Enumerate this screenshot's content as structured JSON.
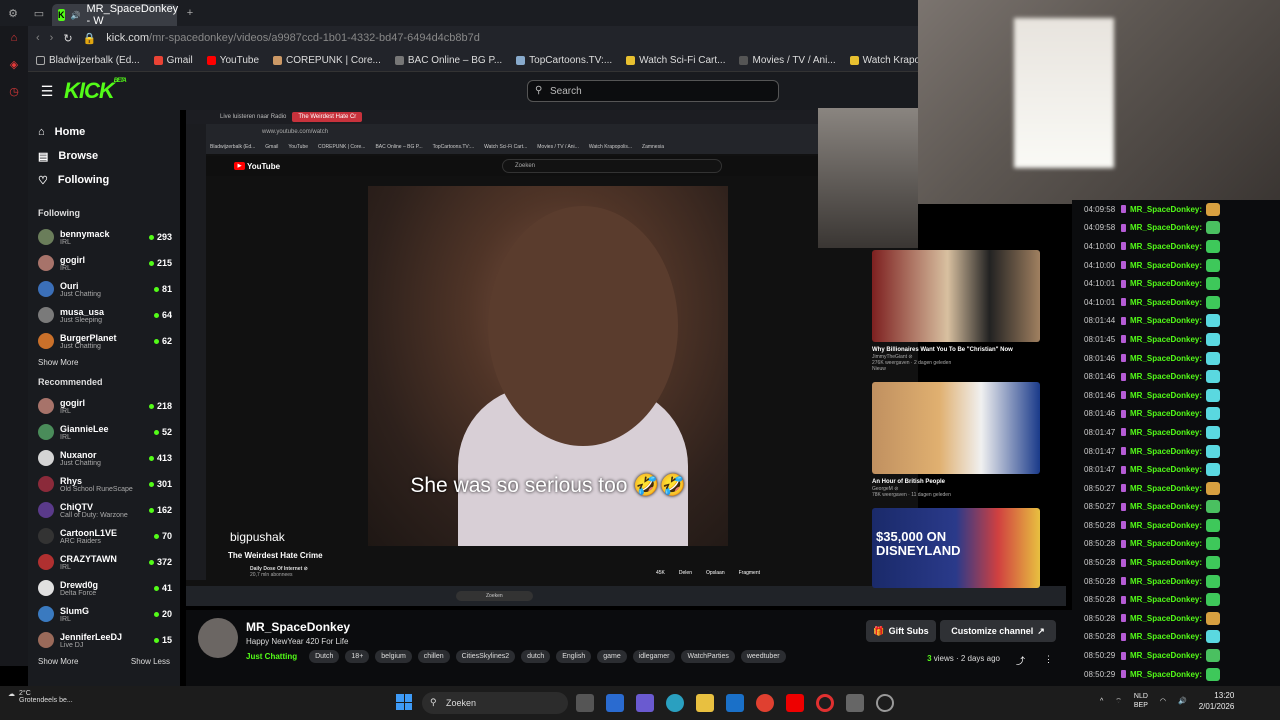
{
  "browser": {
    "tab_title": "MR_SpaceDonkey - W",
    "url_host": "kick.com",
    "url_path": "/mr-spacedonkey/videos/a9987ccd-1b01-4332-bd47-6494d4cb8b7d",
    "bookmarks": [
      "Bladwijzerbalk (Ed...",
      "Gmail",
      "YouTube",
      "COREPUNK | Core...",
      "BAC Online – BG P...",
      "TopCartoons.TV:...",
      "Watch Sci-Fi Cart...",
      "Movies / TV / Ani...",
      "Watch Krapopolis...",
      "Zamnesia"
    ]
  },
  "kick": {
    "logo": "KICK",
    "search_placeholder": "Search",
    "nav": [
      {
        "label": "Home",
        "icon": "home-icon"
      },
      {
        "label": "Browse",
        "icon": "browse-icon"
      },
      {
        "label": "Following",
        "icon": "heart-icon"
      }
    ],
    "following_title": "Following",
    "following": [
      {
        "name": "bennymack",
        "category": "IRL",
        "viewers": "293",
        "color": "#6a7d5a"
      },
      {
        "name": "gogirl",
        "category": "IRL",
        "viewers": "215",
        "color": "#a7736a"
      },
      {
        "name": "Ouri",
        "category": "Just Chatting",
        "viewers": "81",
        "color": "#3b6fb8"
      },
      {
        "name": "musa_usa",
        "category": "Just Sleeping",
        "viewers": "64",
        "color": "#7a7a7a"
      },
      {
        "name": "BurgerPlanet",
        "category": "Just Chatting",
        "viewers": "62",
        "color": "#c9702a"
      }
    ],
    "show_more": "Show More",
    "recommended_title": "Recommended",
    "recommended": [
      {
        "name": "gogirl",
        "category": "IRL",
        "viewers": "218",
        "color": "#a7736a"
      },
      {
        "name": "GiannieLee",
        "category": "IRL",
        "viewers": "52",
        "color": "#4a8c5a"
      },
      {
        "name": "Nuxanor",
        "category": "Just Chatting",
        "viewers": "413",
        "color": "#d4d4d4"
      },
      {
        "name": "Rhys",
        "category": "Old School RuneScape",
        "viewers": "301",
        "color": "#8b2a3a"
      },
      {
        "name": "ChiQTV",
        "category": "Call of Duty: Warzone",
        "viewers": "162",
        "color": "#5a3a8a"
      },
      {
        "name": "CartoonL1VE",
        "category": "ARC Raiders",
        "viewers": "70",
        "color": "#333333"
      },
      {
        "name": "CRAZYTAWN",
        "category": "IRL",
        "viewers": "372",
        "color": "#b03030"
      },
      {
        "name": "Drewd0g",
        "category": "Delta Force",
        "viewers": "41",
        "color": "#e0e0e0"
      },
      {
        "name": "SlumG",
        "category": "IRL",
        "viewers": "20",
        "color": "#3a7ac0"
      },
      {
        "name": "JenniferLeeDJ",
        "category": "Live DJ",
        "viewers": "15",
        "color": "#9a6a5a"
      }
    ],
    "show_less": "Show Less"
  },
  "inner": {
    "tab1": "Live luisteren naar Radio",
    "tab2": "The Weirdest Hate Cr",
    "url": "www.youtube.com/watch",
    "yt_logo": "YouTube",
    "yt_search": "Zoeken",
    "caption": "She was so serious too 🤣🤣",
    "watermark": "bigpushak",
    "video_title": "The Weirdest Hate Crime",
    "channel": "Daily Dose Of Internet ⊘",
    "subs": "20,7 mln abonnees",
    "likes": "45K",
    "share": "Delen",
    "save": "Opslaan",
    "clip": "Fragment",
    "taskbar_search": "Zoeken",
    "related": [
      {
        "title": "Why Billionaires Want You To Be \"Christian\" Now",
        "channel": "JimmyTheGiant ⊘",
        "meta": "276K weergaven · 2 dagen geleden",
        "badge": "Nieuw"
      },
      {
        "title": "An Hour of British People",
        "channel": "GeorgeM ⊘",
        "meta": "78K weergaven · 11 dagen geleden",
        "badge": ""
      },
      {
        "title": "$35,000 ON DISNEYLAND",
        "channel": "",
        "meta": "",
        "badge": ""
      }
    ]
  },
  "chat": {
    "user": "MR_SpaceDonkey:",
    "times": [
      "04:09:58",
      "04:09:58",
      "04:10:00",
      "04:10:00",
      "04:10:01",
      "04:10:01",
      "08:01:44",
      "08:01:45",
      "08:01:46",
      "08:01:46",
      "08:01:46",
      "08:01:46",
      "08:01:47",
      "08:01:47",
      "08:01:47",
      "08:50:27",
      "08:50:27",
      "08:50:28",
      "08:50:28",
      "08:50:28",
      "08:50:28",
      "08:50:28",
      "08:50:28",
      "08:50:28",
      "08:50:29",
      "08:50:29"
    ],
    "emote_colors": [
      "#d8a040",
      "#4ac060",
      "#3ec85a",
      "#3ec85a",
      "#3ec85a",
      "#3ec85a",
      "#5ad8e0",
      "#5ad8e0",
      "#5ad8e0",
      "#5ad8e0",
      "#5ad8e0",
      "#5ad8e0",
      "#5ad8e0",
      "#5ad8e0",
      "#5ad8e0",
      "#d8a040",
      "#4ac060",
      "#3ec85a",
      "#3ec85a",
      "#3ec85a",
      "#3ec85a",
      "#3ec85a",
      "#d8a040",
      "#5ad8e0",
      "#4ac060",
      "#3ec85a"
    ]
  },
  "channel_info": {
    "name": "MR_SpaceDonkey",
    "title": "Happy NewYear 420 For Life",
    "category": "Just Chatting",
    "tags": [
      "Dutch",
      "18+",
      "belgium",
      "chillen",
      "CitiesSkylines2",
      "dutch",
      "English",
      "game",
      "idlegamer",
      "WatchParties",
      "weedtuber"
    ],
    "gift_subs": "Gift Subs",
    "customize": "Customize channel",
    "views_count": "3",
    "views_label": " views",
    "ago": " · 2 days ago"
  },
  "taskbar": {
    "weather_temp": "2°C",
    "weather_desc": "Grotendeels be...",
    "search": "Zoeken",
    "lang1": "NLD",
    "lang2": "BEP",
    "time": "13:20",
    "date": "2/01/2026"
  }
}
